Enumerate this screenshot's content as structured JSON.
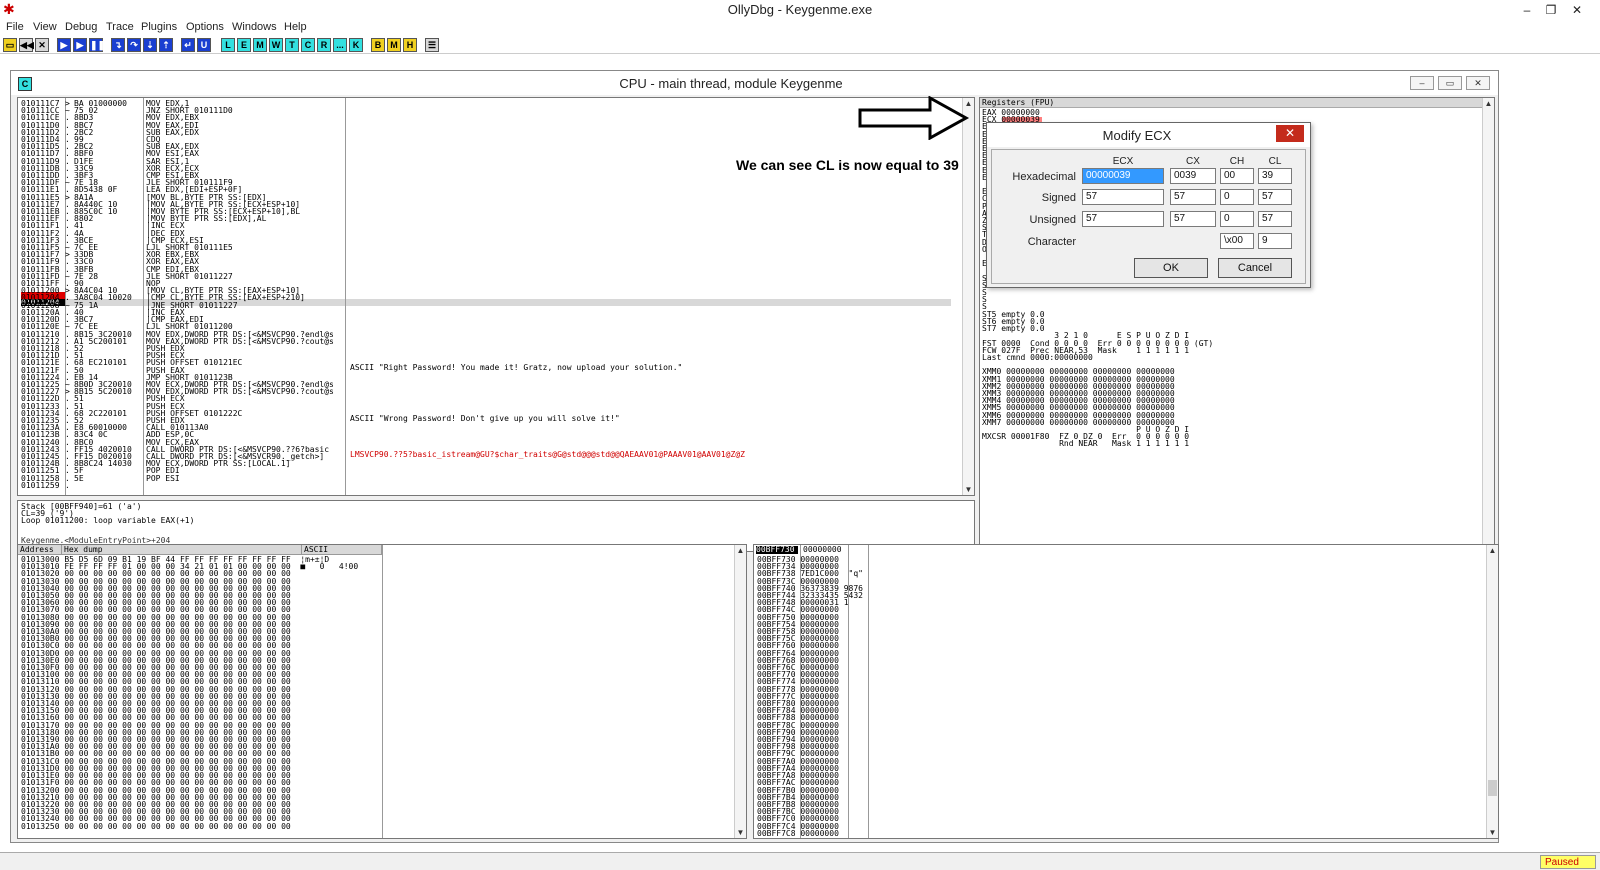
{
  "window": {
    "title": "OllyDbg - Keygenme.exe",
    "icon": "bug-icon"
  },
  "menu": [
    "File",
    "View",
    "Debug",
    "Trace",
    "Plugins",
    "Options",
    "Windows",
    "Help"
  ],
  "toolbar": {
    "file_buttons": [
      "open",
      "restart",
      "close"
    ],
    "run_buttons": [
      "run",
      "pause",
      "stop",
      "step-into",
      "step-over",
      "trace-into",
      "trace-over",
      "execute-till-return",
      "user-code"
    ],
    "window_buttons": [
      "L",
      "E",
      "M",
      "W",
      "T",
      "C",
      "R",
      "...",
      "K"
    ],
    "extra_buttons": [
      "B",
      "M",
      "H"
    ]
  },
  "cpu": {
    "title": "CPU - main thread, module Keygenme",
    "icon_letter": "C",
    "disasm": {
      "addresses": "010111C7\n010111CC\n010111CE\n010111D0\n010111D2\n010111D4\n010111D5\n010111D7\n010111D9\n010111DB\n010111DD\n010111DF\n010111E1\n010111E5\n010111E7\n010111EB\n010111EF\n010111F1\n010111F2\n010111F3\n010111F5\n010111F7\n010111F9\n010111FB\n010111FD\n010111FF\n01011200\n01011204\n01011208\n0101120A\n0101120D\n0101120E\n01011210\n01011212\n01011218\n0101121D\n0101121E\n0101121F\n01011224\n01011225\n01011227\n0101122D\n01011233\n01011234\n01011235\n0101123A\n0101123B\n01011240\n01011243\n01011245\n0101124B\n01011251\n01011258\n01011259",
      "marks": ">\n~\n.\n.\n.\n.\n.\n.\n.\n.\n.\n~\n.\n>\n.\n.\n.\n.\n.\n.\n~\n>\n.\n.\n~\n.\n>\n.\n~\n.\n.\n~\n.\n.\n.\n.\n.\n.\n.\n~\n>\n.\n.\n.\n.\n.\n.\n.\n.\n.\n.\n.\n.\n.",
      "hex": "BA 01000000\n75 02\n8BD3\n8BC7\n2BC2\n99\n2BC2\n8BF0\nD1FE\n33C9\n3BF3\n7E 18\n8D5438 0F\n8A1A\n8A440C 10\n885C0C 10\n8802\n41\n4A\n3BCE\n7C EE\n33DB\n33C0\n3BFB\n7E 28\n90\n8A4C04 10\n3A8C04 10020\n75 1A\n40\n3BC7\n7C EE\n8B15 3C20010\nA1 5C200101\n52\n51\n68 EC210101\n50\nEB 14\n8B0D 3C20010\n8B15 5C20010\n51\n51\n68 2C220101\n52\nE8 60010000\n83C4 0C\n8BC0\nFF15 4020010\nFF15 D020010\n8B8C24 14030\n5F\n5E",
      "instructions": "MOV EDX,1\nJNZ SHORT 010111D0\nMOV EDX,EBX\nMOV EAX,EDI\nSUB EAX,EDX\nCDQ\nSUB EAX,EDX\nMOV ESI,EAX\nSAR ESI,1\nXOR ECX,ECX\nCMP ESI,EBX\nJLE SHORT 010111F9\nLEA EDX,[EDI+ESP+0F]\n[MOV BL,BYTE PTR SS:[EDX]\n|MOV AL,BYTE PTR SS:[ECX+ESP+10]\n|MOV BYTE PTR SS:[ECX+ESP+10],BL\n|MOV BYTE PTR SS:[EDX],AL\n|INC ECX\n|DEC EDX\n|CMP ECX,ESI\nLJL SHORT 010111E5\nXOR EBX,EBX\nXOR EAX,EAX\nCMP EDI,EBX\nJLE SHORT 01011227\nNOP\n[MOV CL,BYTE PTR SS:[EAX+ESP+10]\n|CMP CL,BYTE PTR SS:[EAX+ESP+210]\n|JNE SHORT 01011227\n|INC EAX\n|CMP EAX,EDI\nLJL SHORT 01011200\nMOV EDX,DWORD PTR DS:[<&MSVCP90.?endl@s\nMOV EAX,DWORD PTR DS:[<&MSVCP90.?cout@s\nPUSH EDX\nPUSH ECX\nPUSH OFFSET 010121EC\nPUSH EAX\nJMP SHORT 0101123B\nMOV ECX,DWORD PTR DS:[<&MSVCP90.?endl@s\nMOV EDX,DWORD PTR DS:[<&MSVCP90.?cout@s\nPUSH ECX\nPUSH ECX\nPUSH OFFSET 0101222C\nPUSH EDX\nCALL 010113A0\nADD ESP,0C\nMOV ECX,EAX\nCALL DWORD PTR DS:[<&MSVCP90.??6?basic\nCALL DWORD PTR DS:[<&MSVCR90._getch>]\nMOV ECX,DWORD PTR SS:[LOCAL.1]\nPOP EDI\nPOP ESI",
      "comment_right": "ASCII \"Right Password! You made it! Gratz, now upload your solution.\"",
      "comment_wrong": "ASCII \"Wrong Password! Don't give up you will solve it!\"",
      "comment_call": "LMSVCP90.??5?basic_istream@GU?$char_traits@G@std@@@std@@QAEAAV01@PAAAV01@AAV01@Z@Z",
      "eip_address": "01011204",
      "bp_address": "01011200",
      "highlight_color": "#d00000"
    },
    "info": {
      "text": "Stack [00BFF940]=61 ('a')\nCL=39 ('9')\nLoop 01011200: loop variable EAX(+1)",
      "footer": "Keygenme.<ModuleEntryPoint>+204"
    },
    "registers": {
      "header": "Registers (FPU)",
      "text": "EAX 00000000\nECX 00000039\nE\nE\nE\nE\nE\nE\nE\nE\n\nE\nC\nP\nA\nZ\nS\nT\nD\nO\n\nE\n\nS\nS\nS\nS\nS\nST5 empty 0.0\nST6 empty 0.0\nST7 empty 0.0\n               3 2 1 0      E S P U O Z D I\nFST 0000  Cond 0 0 0 0  Err 0 0 0 0 0 0 0 0 (GT)\nFCW 027F  Prec NEAR,53  Mask    1 1 1 1 1 1\nLast cmnd 0000:00000000\n\nXMM0 00000000 00000000 00000000 00000000\nXMM1 00000000 00000000 00000000 00000000\nXMM2 00000000 00000000 00000000 00000000\nXMM3 00000000 00000000 00000000 00000000\nXMM4 00000000 00000000 00000000 00000000\nXMM5 00000000 00000000 00000000 00000000\nXMM6 00000000 00000000 00000000 00000000\nXMM7 00000000 00000000 00000000 00000000\n                                P U O Z D I\nMXCSR 00001F80  FZ 0 DZ 0  Err  0 0 0 0 0 0\n                Rnd NEAR   Mask 1 1 1 1 1 1",
      "highlight_color": "#ff8080"
    },
    "dump": {
      "headers": [
        "Address",
        "Hex dump",
        "ASCII"
      ],
      "text": "01013000 B5 D5 6D 09 B1 19 BF 44 FF FF FF FF FF FF FF FF  ¦m+±¦D\n01013010 FE FF FF FF 01 00 00 00 34 21 01 01 00 00 00 00  ■   0   4!00\n01013020 00 00 00 00 00 00 00 00 00 00 00 00 00 00 00 00\n01013030 00 00 00 00 00 00 00 00 00 00 00 00 00 00 00 00\n01013040 00 00 00 00 00 00 00 00 00 00 00 00 00 00 00 00\n01013050 00 00 00 00 00 00 00 00 00 00 00 00 00 00 00 00\n01013060 00 00 00 00 00 00 00 00 00 00 00 00 00 00 00 00\n01013070 00 00 00 00 00 00 00 00 00 00 00 00 00 00 00 00\n01013080 00 00 00 00 00 00 00 00 00 00 00 00 00 00 00 00\n01013090 00 00 00 00 00 00 00 00 00 00 00 00 00 00 00 00\n010130A0 00 00 00 00 00 00 00 00 00 00 00 00 00 00 00 00\n010130B0 00 00 00 00 00 00 00 00 00 00 00 00 00 00 00 00\n010130C0 00 00 00 00 00 00 00 00 00 00 00 00 00 00 00 00\n010130D0 00 00 00 00 00 00 00 00 00 00 00 00 00 00 00 00\n010130E0 00 00 00 00 00 00 00 00 00 00 00 00 00 00 00 00\n010130F0 00 00 00 00 00 00 00 00 00 00 00 00 00 00 00 00\n01013100 00 00 00 00 00 00 00 00 00 00 00 00 00 00 00 00\n01013110 00 00 00 00 00 00 00 00 00 00 00 00 00 00 00 00\n01013120 00 00 00 00 00 00 00 00 00 00 00 00 00 00 00 00\n01013130 00 00 00 00 00 00 00 00 00 00 00 00 00 00 00 00\n01013140 00 00 00 00 00 00 00 00 00 00 00 00 00 00 00 00\n01013150 00 00 00 00 00 00 00 00 00 00 00 00 00 00 00 00\n01013160 00 00 00 00 00 00 00 00 00 00 00 00 00 00 00 00\n01013170 00 00 00 00 00 00 00 00 00 00 00 00 00 00 00 00\n01013180 00 00 00 00 00 00 00 00 00 00 00 00 00 00 00 00\n01013190 00 00 00 00 00 00 00 00 00 00 00 00 00 00 00 00\n010131A0 00 00 00 00 00 00 00 00 00 00 00 00 00 00 00 00\n010131B0 00 00 00 00 00 00 00 00 00 00 00 00 00 00 00 00\n010131C0 00 00 00 00 00 00 00 00 00 00 00 00 00 00 00 00\n010131D0 00 00 00 00 00 00 00 00 00 00 00 00 00 00 00 00\n010131E0 00 00 00 00 00 00 00 00 00 00 00 00 00 00 00 00\n010131F0 00 00 00 00 00 00 00 00 00 00 00 00 00 00 00 00\n01013200 00 00 00 00 00 00 00 00 00 00 00 00 00 00 00 00\n01013210 00 00 00 00 00 00 00 00 00 00 00 00 00 00 00 00\n01013220 00 00 00 00 00 00 00 00 00 00 00 00 00 00 00 00\n01013230 00 00 00 00 00 00 00 00 00 00 00 00 00 00 00 00\n01013240 00 00 00 00 00 00 00 00 00 00 00 00 00 00 00 00\n01013250 00 00 00 00 00 00 00 00 00 00 00 00 00 00 00 00"
    },
    "stack": {
      "top_address": "00BFF730",
      "top_value": "00000000",
      "text": "00BFF730 00000000\n00BFF734 00000000 \n00BFF738 7ED1C000  \"q\"\n00BFF73C 00000000\n00BFF740 36373839 9876\n00BFF744 32333435 5432\n00BFF748 00000031 1\n00BFF74C 00000000\n00BFF750 00000000\n00BFF754 00000000\n00BFF758 00000000\n00BFF75C 00000000\n00BFF760 00000000\n00BFF764 00000000\n00BFF768 00000000\n00BFF76C 00000000\n00BFF770 00000000\n00BFF774 00000000\n00BFF778 00000000\n00BFF77C 00000000\n00BFF780 00000000\n00BFF784 00000000\n00BFF788 00000000\n00BFF78C 00000000\n00BFF790 00000000\n00BFF794 00000000\n00BFF798 00000000\n00BFF79C 00000000\n00BFF7A0 00000000\n00BFF7A4 00000000\n00BFF7A8 00000000\n00BFF7AC 00000000\n00BFF7B0 00000000\n00BFF7B4 00000000\n00BFF7B8 00000000\n00BFF7BC 00000000\n00BFF7C0 00000000\n00BFF7C4 00000000\n00BFF7C8 00000000"
    }
  },
  "annotation": {
    "text": "We can see CL is now equal to 39"
  },
  "dialog": {
    "title": "Modify ECX",
    "col_headers": [
      "ECX",
      "CX",
      "CH",
      "CL"
    ],
    "rows": [
      {
        "label": "Hexadecimal",
        "values": [
          "00000039",
          "0039",
          "00",
          "39"
        ]
      },
      {
        "label": "Signed",
        "values": [
          "57",
          "57",
          "0",
          "57"
        ]
      },
      {
        "label": "Unsigned",
        "values": [
          "57",
          "57",
          "0",
          "57"
        ]
      },
      {
        "label": "Character",
        "values": [
          "\\x00",
          "9"
        ]
      }
    ],
    "ok_label": "OK",
    "cancel_label": "Cancel"
  },
  "status": {
    "state": "Paused"
  }
}
